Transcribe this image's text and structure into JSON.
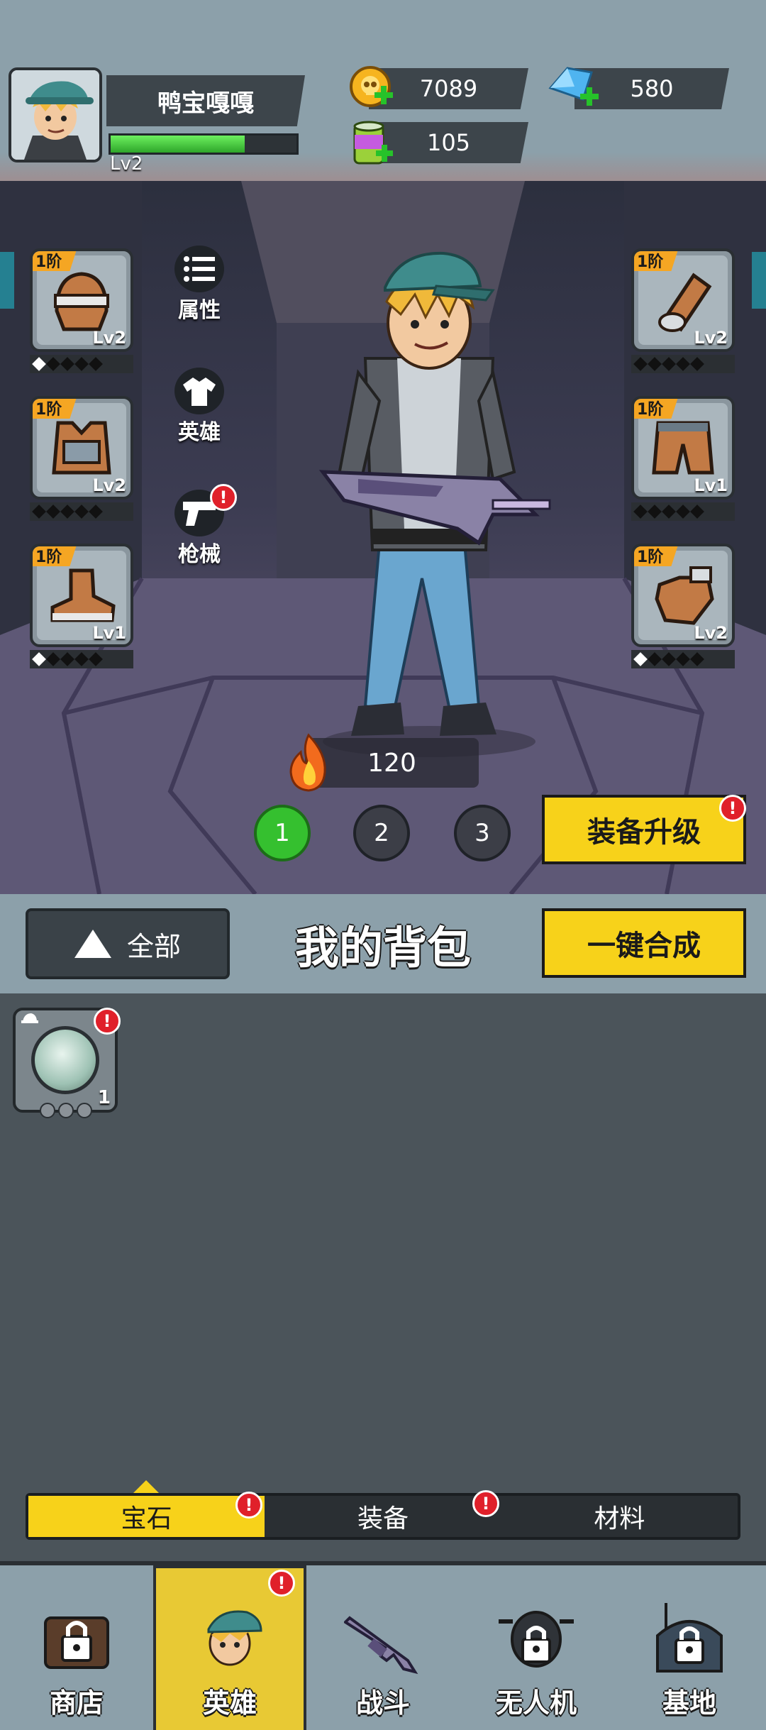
{
  "player": {
    "name": "鸭宝嘎嘎",
    "level": "Lv2",
    "xp_fraction": 0.72
  },
  "resources": {
    "gold": "7089",
    "diamonds": "580",
    "energy": "105"
  },
  "side_menu": {
    "attributes": "属性",
    "hero": "英雄",
    "firearms": "枪械"
  },
  "badge_symbol": "!",
  "equipment": {
    "left": [
      {
        "tier": "1阶",
        "level": "Lv2",
        "stars_on": 1
      },
      {
        "tier": "1阶",
        "level": "Lv2",
        "stars_on": 0
      },
      {
        "tier": "1阶",
        "level": "Lv1",
        "stars_on": 1
      }
    ],
    "right": [
      {
        "tier": "1阶",
        "level": "Lv2",
        "stars_on": 0
      },
      {
        "tier": "1阶",
        "level": "Lv1",
        "stars_on": 0
      },
      {
        "tier": "1阶",
        "level": "Lv2",
        "stars_on": 1
      }
    ]
  },
  "power": "120",
  "pages": [
    "1",
    "2",
    "3"
  ],
  "upgrade_button": "装备升级",
  "bag": {
    "filter": "全部",
    "title": "我的背包",
    "merge_button": "一键合成"
  },
  "inventory": [
    {
      "count": "1"
    }
  ],
  "categories": [
    "宝石",
    "装备",
    "材料"
  ],
  "nav": [
    "商店",
    "英雄",
    "战斗",
    "无人机",
    "基地"
  ],
  "colors": {
    "accent_yellow": "#f7d21a",
    "alert_red": "#e0202a",
    "active_green": "#35c02f"
  }
}
